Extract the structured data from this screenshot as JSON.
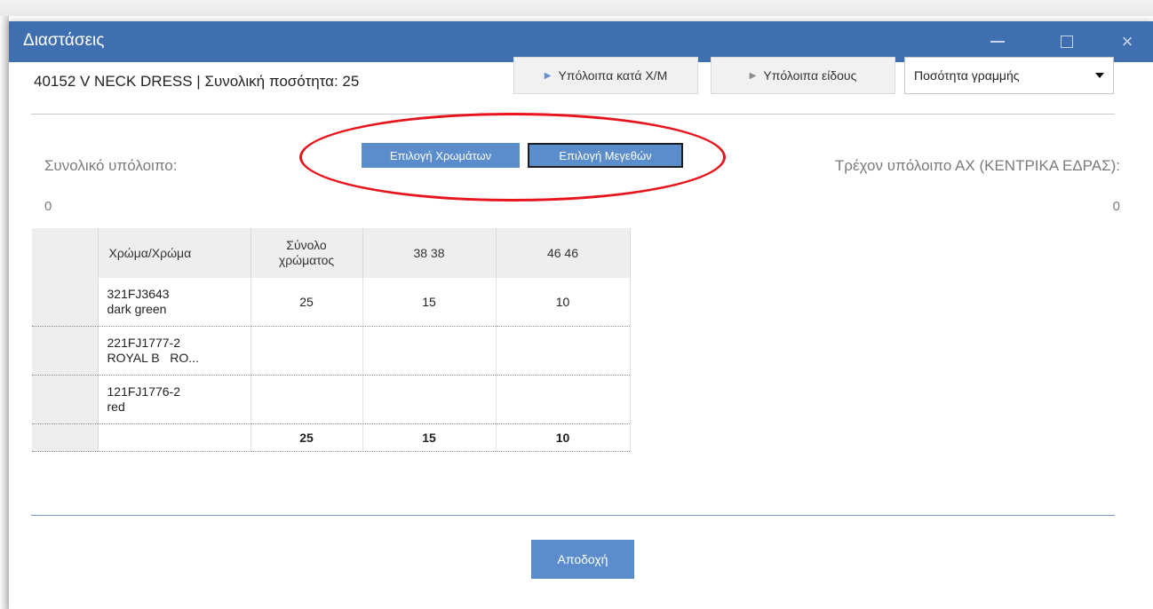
{
  "window": {
    "title": "Διαστάσεις",
    "close_glyph": "×"
  },
  "header": {
    "title": "40152 V NECK DRESS  |  Συνολική ποσότητα: 25",
    "btn_remaining_cm": "Υπόλοιπα κατά Χ/Μ",
    "btn_remaining_item": "Υπόλοιπα είδους",
    "quantity_select": "Ποσότητα γραμμής"
  },
  "summary": {
    "total_label": "Συνολικό υπόλοιπο:",
    "total_value": "0",
    "current_label": "Τρέχον υπόλοιπο ΑΧ (ΚΕΝΤΡΙΚΑ ΕΔΡΑΣ):",
    "current_value": "0"
  },
  "selectors": {
    "colors": "Επιλογή Χρωμάτων",
    "sizes": "Επιλογή Μεγεθών"
  },
  "grid": {
    "headers": {
      "color": "Χρώμα/Χρώμα",
      "total_line1": "Σύνολο",
      "total_line2": "χρώματος",
      "size1": "38  38",
      "size2": "46  46"
    },
    "rows": [
      {
        "code": "321FJ3643",
        "name": "dark green",
        "total": "25",
        "s1": "15",
        "s2": "10"
      },
      {
        "code": "221FJ1777-2",
        "name": "ROYAL B   RO...",
        "total": "",
        "s1": "",
        "s2": ""
      },
      {
        "code": "121FJ1776-2",
        "name": "red",
        "total": "",
        "s1": "",
        "s2": ""
      }
    ],
    "totals": {
      "total": "25",
      "s1": "15",
      "s2": "10"
    }
  },
  "footer": {
    "accept": "Αποδοχή"
  },
  "colors": {
    "titlebar": "#3f6fb0",
    "button_blue": "#5b8ccb",
    "annotation": "#e8141c"
  }
}
